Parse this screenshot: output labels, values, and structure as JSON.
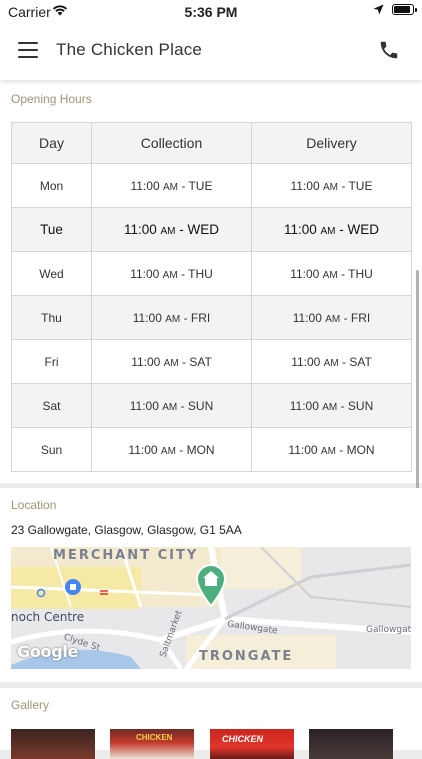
{
  "status_bar": {
    "carrier": "Carrier",
    "time": "5:36 PM"
  },
  "header": {
    "title": "The Chicken Place",
    "menu_icon": "hamburger-icon",
    "phone_icon": "phone-icon"
  },
  "opening_hours": {
    "title": "Opening Hours",
    "columns": [
      "Day",
      "Collection",
      "Delivery"
    ],
    "rows": [
      {
        "day": "Mon",
        "collection_time": "11:00",
        "collection_suffix": "AM",
        "collection_end": "- TUE",
        "delivery_time": "11:00",
        "delivery_suffix": "AM",
        "delivery_end": "- TUE"
      },
      {
        "day": "Tue",
        "collection_time": "11:00",
        "collection_suffix": "AM",
        "collection_end": "- WED",
        "delivery_time": "11:00",
        "delivery_suffix": "AM",
        "delivery_end": "- WED"
      },
      {
        "day": "Wed",
        "collection_time": "11:00",
        "collection_suffix": "AM",
        "collection_end": "- THU",
        "delivery_time": "11:00",
        "delivery_suffix": "AM",
        "delivery_end": "- THU"
      },
      {
        "day": "Thu",
        "collection_time": "11:00",
        "collection_suffix": "AM",
        "collection_end": "- FRI",
        "delivery_time": "11:00",
        "delivery_suffix": "AM",
        "delivery_end": "- FRI"
      },
      {
        "day": "Fri",
        "collection_time": "11:00",
        "collection_suffix": "AM",
        "collection_end": "- SAT",
        "delivery_time": "11:00",
        "delivery_suffix": "AM",
        "delivery_end": "- SAT"
      },
      {
        "day": "Sat",
        "collection_time": "11:00",
        "collection_suffix": "AM",
        "collection_end": "- SUN",
        "delivery_time": "11:00",
        "delivery_suffix": "AM",
        "delivery_end": "- SUN"
      },
      {
        "day": "Sun",
        "collection_time": "11:00",
        "collection_suffix": "AM",
        "collection_end": "- MON",
        "delivery_time": "11:00",
        "delivery_suffix": "AM",
        "delivery_end": "- MON"
      }
    ],
    "today": "Tue"
  },
  "location": {
    "title": "Location",
    "address": "23 Gallowgate, Glasgow, Glasgow, G1 5AA",
    "map": {
      "labels": {
        "merchant_city": "MERCHANT CITY",
        "centre": "noch Centre",
        "clyde": "Clyde St",
        "saltmarket": "Saltmarket",
        "gallowgate_1": "Gallowgate",
        "gallowgate_2": "Gallowgat",
        "trongate": "TRONGATE",
        "google": "Google"
      },
      "marker_icon": "home-pin-icon"
    }
  },
  "gallery": {
    "title": "Gallery",
    "thumb_texts": [
      "",
      "CHICKEN",
      "CHICKEN",
      ""
    ]
  },
  "colors": {
    "section_title": "#9f9476",
    "table_alt_row": "#f3f3f3",
    "map_marker": "#4caf7d"
  }
}
